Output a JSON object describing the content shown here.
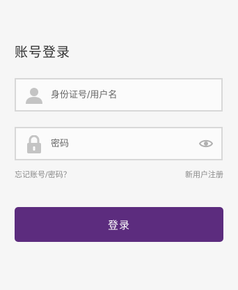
{
  "form": {
    "title": "账号登录",
    "username": {
      "placeholder": "身份证号/用户名",
      "value": "",
      "icon": "user-icon"
    },
    "password": {
      "placeholder": "密码",
      "value": "",
      "icon": "lock-icon",
      "toggle_icon": "eye-icon"
    },
    "forgot_link": "忘记账号/密码？",
    "register_link": "新用户注册",
    "submit_label": "登录"
  },
  "colors": {
    "background": "#f6f6f6",
    "input_border": "#d8d8d8",
    "icon_gray": "#c4c4c4",
    "link_gray": "#8a8a8a",
    "primary": "#5c2c7e",
    "primary_text": "#ffffff"
  }
}
